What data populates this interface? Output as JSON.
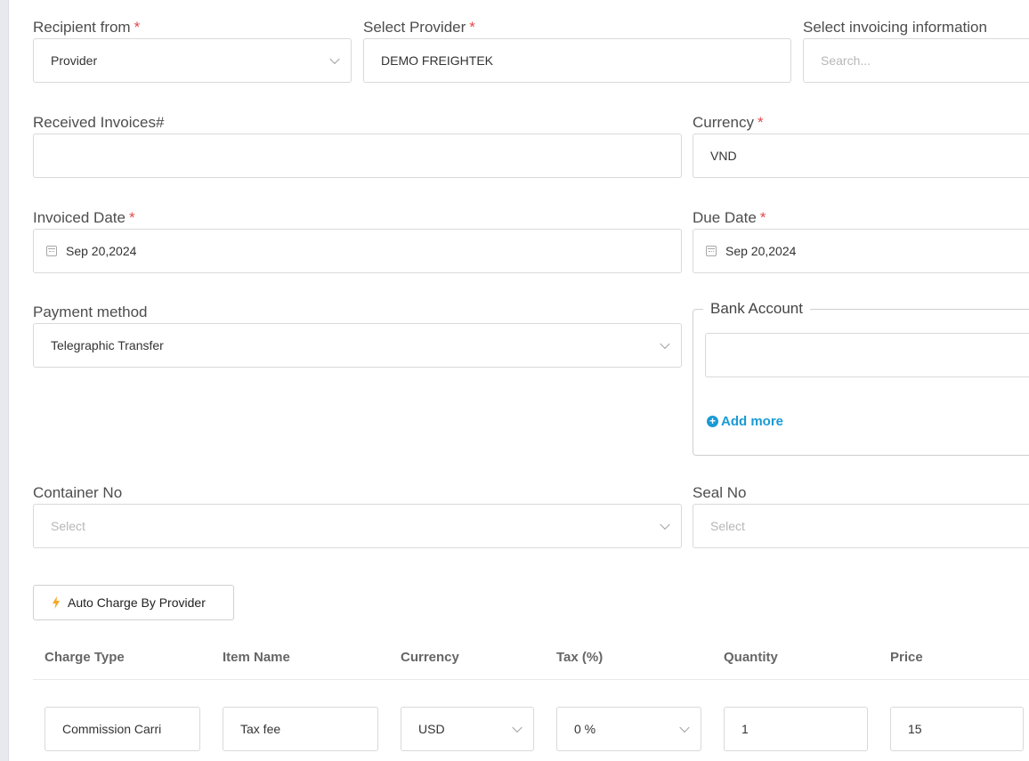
{
  "form": {
    "recipient_from": {
      "label": "Recipient from",
      "required": "*",
      "value": "Provider"
    },
    "select_provider": {
      "label": "Select Provider",
      "required": "*",
      "value": "DEMO FREIGHTEK"
    },
    "select_invoicing_information": {
      "label": "Select invoicing information",
      "placeholder": "Search..."
    },
    "received_invoices": {
      "label": "Received Invoices#",
      "value": ""
    },
    "currency": {
      "label": "Currency",
      "required": "*",
      "value": "VND"
    },
    "invoiced_date": {
      "label": "Invoiced Date",
      "required": "*",
      "value": "Sep 20,2024"
    },
    "due_date": {
      "label": "Due Date",
      "required": "*",
      "value": "Sep 20,2024"
    },
    "payment_method": {
      "label": "Payment method",
      "value": "Telegraphic Transfer"
    },
    "bank_account": {
      "legend": "Bank Account",
      "value": "",
      "add_more": "Add more"
    },
    "container_no": {
      "label": "Container No",
      "placeholder": "Select"
    },
    "seal_no": {
      "label": "Seal No",
      "placeholder": "Select"
    }
  },
  "auto_charge_button": {
    "label": "Auto Charge By Provider",
    "icon": "lightning-bolt-icon",
    "icon_color": "#f5a623"
  },
  "charges_table": {
    "columns": [
      "Charge Type",
      "Item Name",
      "Currency",
      "Tax (%)",
      "Quantity",
      "Price"
    ],
    "rows": [
      {
        "charge_type": "Commission Carri",
        "item_name": "Tax fee",
        "currency": "USD",
        "tax": "0 %",
        "quantity": "1",
        "price": "15"
      }
    ]
  },
  "colors": {
    "required": "#e5484d",
    "link": "#1a9ad6",
    "border": "#d9d9d9"
  }
}
